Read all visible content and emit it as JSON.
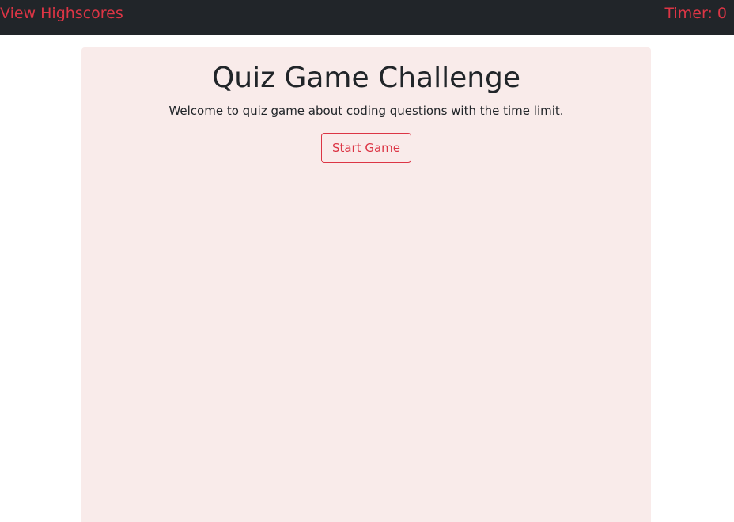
{
  "navbar": {
    "highscores_link": "View Highscores",
    "timer_label": "Timer: 0"
  },
  "quiz_card": {
    "title": "Quiz Game Challenge",
    "description": "Welcome to quiz game about coding questions with the time limit.",
    "start_button": "Start Game"
  },
  "colors": {
    "navbar_bg": "#212529",
    "accent": "#dc3545",
    "card_bg": "#f9ebea",
    "text": "#212529"
  }
}
